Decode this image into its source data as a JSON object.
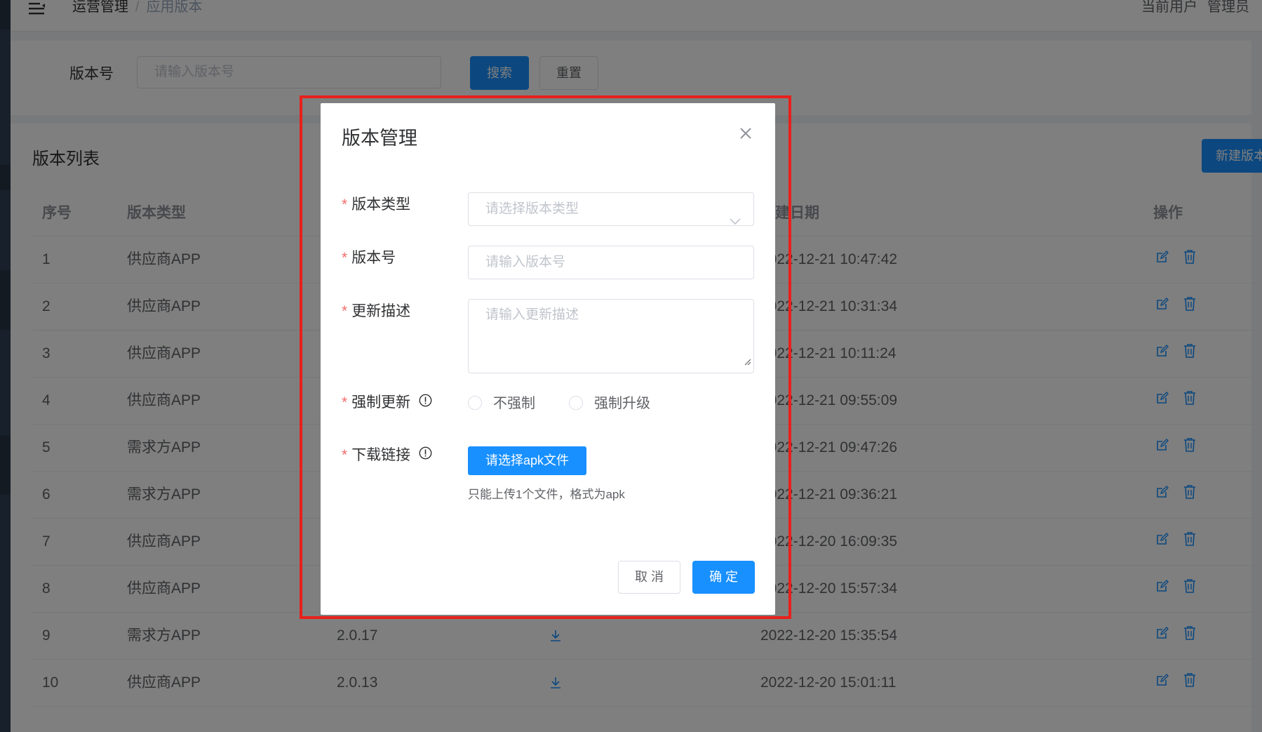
{
  "navbar": {
    "breadcrumb": [
      "运营管理",
      "应用版本"
    ],
    "separator": "/",
    "user_label": "当前用户",
    "user_name": "管理员"
  },
  "search": {
    "label": "版本号",
    "placeholder": "请输入版本号",
    "search_button": "搜索",
    "reset_button": "重置"
  },
  "list": {
    "title": "版本列表",
    "new_button": "新建版本",
    "columns": {
      "index": "序号",
      "type": "版本类型",
      "date": "创建日期",
      "actions": "操作"
    },
    "rows": [
      {
        "index": "1",
        "type": "供应商APP",
        "version": "",
        "date": "2022-12-21 10:47:42"
      },
      {
        "index": "2",
        "type": "供应商APP",
        "version": "",
        "date": "2022-12-21 10:31:34"
      },
      {
        "index": "3",
        "type": "供应商APP",
        "version": "",
        "date": "2022-12-21 10:11:24"
      },
      {
        "index": "4",
        "type": "供应商APP",
        "version": "",
        "date": "2022-12-21 09:55:09"
      },
      {
        "index": "5",
        "type": "需求方APP",
        "version": "",
        "date": "2022-12-21 09:47:26"
      },
      {
        "index": "6",
        "type": "需求方APP",
        "version": "",
        "date": "2022-12-21 09:36:21"
      },
      {
        "index": "7",
        "type": "供应商APP",
        "version": "",
        "date": "2022-12-20 16:09:35"
      },
      {
        "index": "8",
        "type": "供应商APP",
        "version": "",
        "date": "2022-12-20 15:57:34"
      },
      {
        "index": "9",
        "type": "需求方APP",
        "version": "2.0.17",
        "date": "2022-12-20 15:35:54"
      },
      {
        "index": "10",
        "type": "供应商APP",
        "version": "2.0.13",
        "date": "2022-12-20 15:01:11"
      }
    ]
  },
  "dialog": {
    "title": "版本管理",
    "required_mark": "*",
    "version_type": {
      "label": "版本类型",
      "placeholder": "请选择版本类型"
    },
    "version_no": {
      "label": "版本号",
      "placeholder": "请输入版本号"
    },
    "description": {
      "label": "更新描述",
      "placeholder": "请输入更新描述"
    },
    "force_update": {
      "label": "强制更新",
      "options": [
        "不强制",
        "强制升级"
      ]
    },
    "download": {
      "label": "下载链接",
      "button": "请选择apk文件",
      "tip": "只能上传1个文件，格式为apk"
    },
    "cancel_button": "取 消",
    "ok_button": "确 定"
  },
  "colors": {
    "primary": "#1890ff",
    "required": "#f56c6c",
    "highlight": "#e8201a"
  }
}
